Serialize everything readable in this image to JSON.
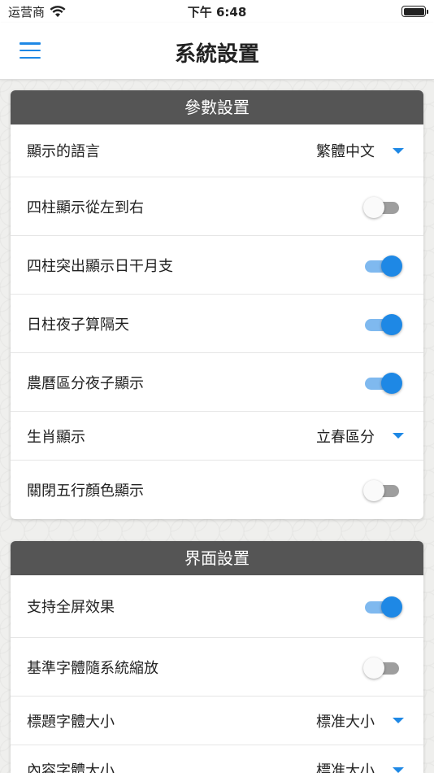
{
  "status_bar": {
    "carrier": "运营商",
    "time": "下午 6:48",
    "wifi_icon": "wifi-icon",
    "battery_icon": "battery-icon"
  },
  "nav": {
    "title": "系統設置",
    "menu_icon": "hamburger-menu-icon"
  },
  "colors": {
    "accent": "#1e88e5",
    "header_bg": "#555555"
  },
  "sections": [
    {
      "title": "參數設置",
      "rows": [
        {
          "label": "顯示的語言",
          "type": "dropdown",
          "value": "繁體中文"
        },
        {
          "label": "四柱顯示從左到右",
          "type": "toggle",
          "on": false
        },
        {
          "label": "四柱突出顯示日干月支",
          "type": "toggle",
          "on": true
        },
        {
          "label": "日柱夜子算隔天",
          "type": "toggle",
          "on": true
        },
        {
          "label": "農曆區分夜子顯示",
          "type": "toggle",
          "on": true
        },
        {
          "label": "生肖顯示",
          "type": "dropdown",
          "value": "立春區分"
        },
        {
          "label": "關閉五行顏色顯示",
          "type": "toggle",
          "on": false
        }
      ]
    },
    {
      "title": "界面設置",
      "rows": [
        {
          "label": "支持全屏效果",
          "type": "toggle",
          "on": true
        },
        {
          "label": "基準字體隨系統縮放",
          "type": "toggle",
          "on": false
        },
        {
          "label": "標題字體大小",
          "type": "dropdown",
          "value": "標准大小"
        },
        {
          "label": "內容字體大小",
          "type": "dropdown",
          "value": "標准大小"
        }
      ]
    }
  ]
}
